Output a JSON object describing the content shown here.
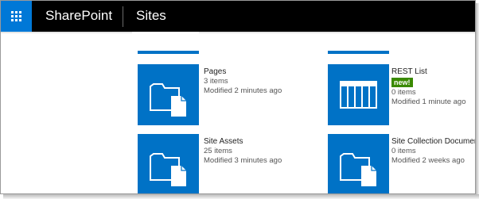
{
  "suite_bar": {
    "brand": "SharePoint",
    "section": "Sites",
    "app_launcher_icon": "waffle-icon",
    "accent_color": "#0078d7"
  },
  "tiles": [
    {
      "name": "Pages",
      "items": "3 items",
      "modified": "Modified 2 minutes ago",
      "icon": "document-library-icon"
    },
    {
      "name": "REST List",
      "badge": "new!",
      "items": "0 items",
      "modified": "Modified 1 minute ago",
      "icon": "list-icon"
    },
    {
      "name": "Site Assets",
      "items": "25 items",
      "modified": "Modified 3 minutes ago",
      "icon": "document-library-icon"
    },
    {
      "name": "Site Collection Documents",
      "items": "0 items",
      "modified": "Modified 2 weeks ago",
      "icon": "document-library-icon"
    }
  ],
  "colors": {
    "tile": "#0072c6",
    "badge": "#3a8a00",
    "suite_bar": "#000000"
  }
}
